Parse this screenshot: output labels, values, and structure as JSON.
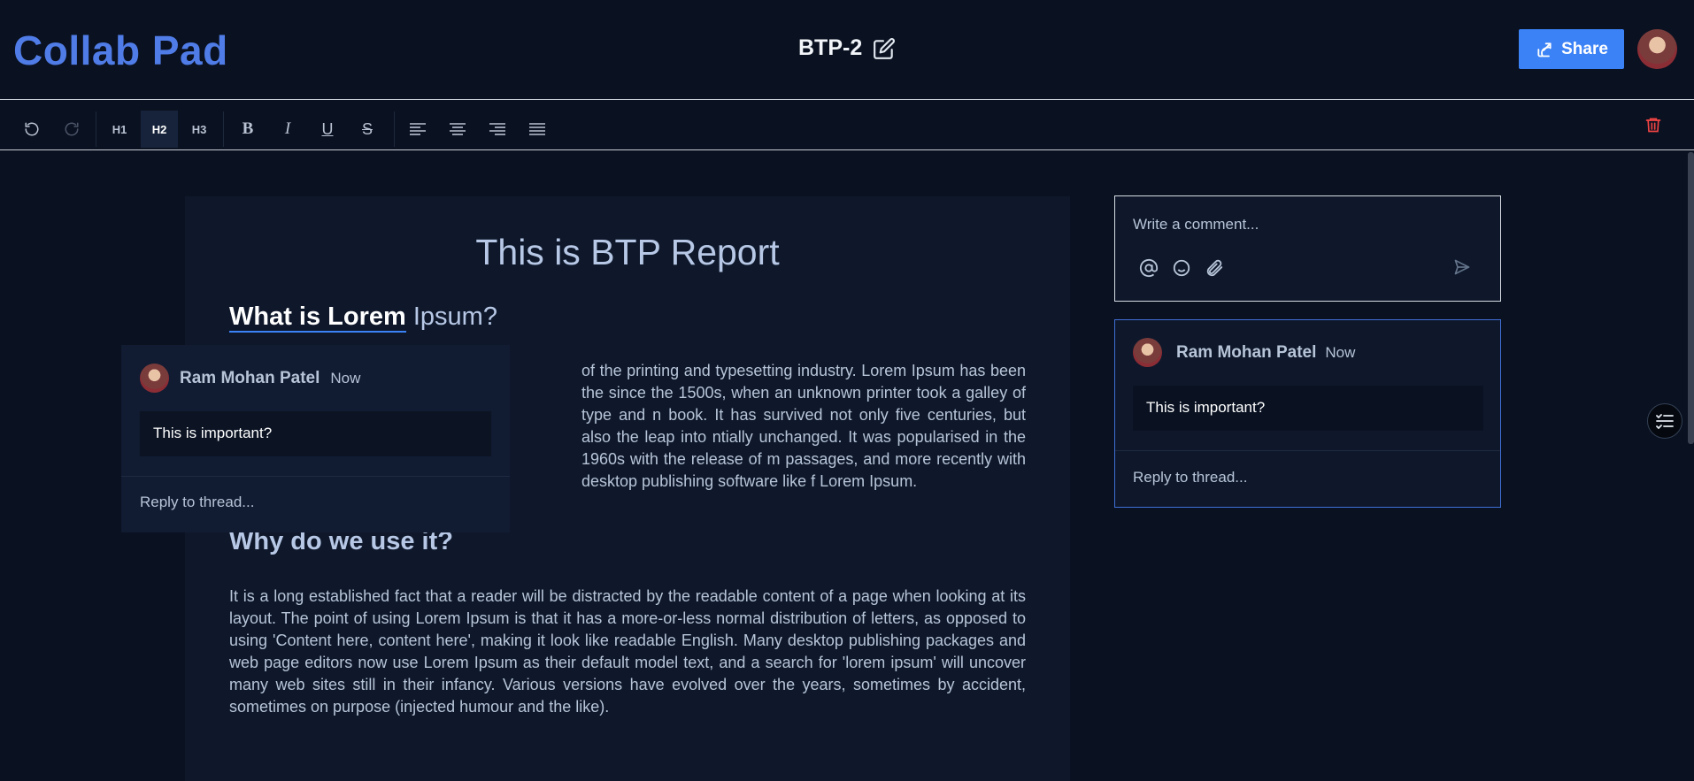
{
  "app": {
    "name": "Collab Pad"
  },
  "header": {
    "doc_title": "BTP-2",
    "share_label": "Share"
  },
  "toolbar": {
    "h1": "H1",
    "h2": "H2",
    "h3": "H3",
    "bold": "B",
    "italic": "I",
    "underline": "U",
    "strike": "S",
    "active_heading": "H2"
  },
  "document": {
    "title": "This is BTP Report",
    "section1": {
      "heading_highlight": "What is Lorem",
      "heading_rest": " Ipsum?",
      "paragraph": "of the printing and typesetting industry. Lorem Ipsum has been the since the 1500s, when an unknown printer took a galley of type and n book. It has survived not only five centuries, but also the leap into ntially unchanged. It was popularised in the 1960s with the release of m passages, and more recently with desktop publishing software like f Lorem Ipsum."
    },
    "section2": {
      "heading": "Why do we use it?",
      "paragraph": "It is a long established fact that a reader will be distracted by the readable content of a page when looking at its layout. The point of using Lorem Ipsum is that it has a more-or-less normal distribution of letters, as opposed to using 'Content here, content here', making it look like readable English. Many desktop publishing packages and web page editors now use Lorem Ipsum as their default model text, and a search for 'lorem ipsum' will uncover many web sites still in their infancy. Various versions have evolved over the years, sometimes by accident, sometimes on purpose (injected humour and the like)."
    }
  },
  "popup_comment": {
    "user": "Ram Mohan Patel",
    "time": "Now",
    "text": "This is important?",
    "reply_placeholder": "Reply to thread..."
  },
  "comment_box": {
    "placeholder": "Write a comment..."
  },
  "thread": {
    "user": "Ram Mohan Patel",
    "time": "Now",
    "text": "This is important?",
    "reply_placeholder": "Reply to thread..."
  },
  "colors": {
    "accent": "#3b82f6",
    "brand": "#4f7ce6",
    "danger": "#ef4444",
    "background": "#0a1120"
  }
}
